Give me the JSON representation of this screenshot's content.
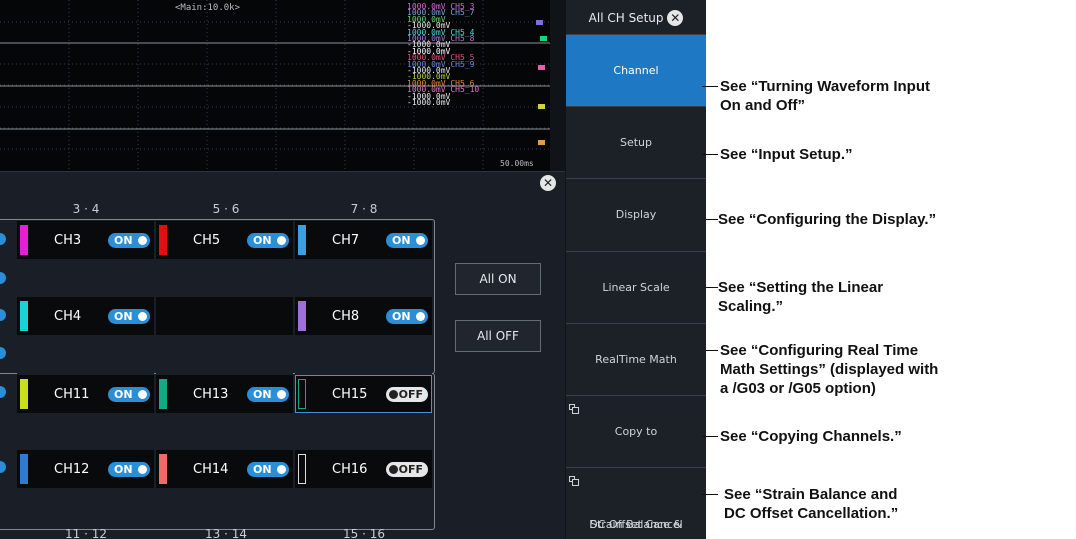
{
  "waveform": {
    "timebase": "<Main:10.0k>",
    "time_div": "50.00ms",
    "trace_labels": [
      {
        "text": "1000.0mV CH5_3",
        "color": "#d46ad4"
      },
      {
        "text": "1000.0mV CH5_7",
        "color": "#7fa0d6"
      },
      {
        "text": "1000.0mV",
        "color": "#6fd36f"
      },
      {
        "text": "-1000.0mV",
        "color": "#e8e8e8"
      },
      {
        "text": "1000.0mV CH5_4",
        "color": "#4fd8d8"
      },
      {
        "text": "1000.0mV CH5_8",
        "color": "#b07ad8"
      },
      {
        "text": "-1000.0mV",
        "color": "#e8e8e8"
      },
      {
        "text": "-1000.0mV",
        "color": "#ffffff"
      },
      {
        "text": "1000.0mV CH5_5",
        "color": "#e0507a"
      },
      {
        "text": "1000.0mV CH5_9",
        "color": "#6a86e0"
      },
      {
        "text": "-1000.0mV",
        "color": "#e8e8e8"
      },
      {
        "text": "-1000.0mV",
        "color": "#b8d040"
      },
      {
        "text": "1000.0mV CH5_6",
        "color": "#e08a40"
      },
      {
        "text": "1000.0mV CH5_10",
        "color": "#d87ac0"
      },
      {
        "text": "-1000.0mV",
        "color": "#e8e8e8"
      },
      {
        "text": "-1000.0mV",
        "color": "#e8e8e8"
      }
    ]
  },
  "panel": {
    "column_headers": [
      "3 · 4",
      "5 · 6",
      "7 · 8"
    ],
    "column_footers": [
      "11 · 12",
      "13 · 14",
      "15 · 16"
    ],
    "channels": [
      {
        "label": "CH3",
        "state": "ON",
        "color": "#e61fd6"
      },
      {
        "label": "CH5",
        "state": "ON",
        "color": "#e01010"
      },
      {
        "label": "CH7",
        "state": "ON",
        "color": "#3d9ee0"
      },
      {
        "label": "CH4",
        "state": "ON",
        "color": "#19d3d8"
      },
      {
        "label": "CH8",
        "state": "ON",
        "color": "#a070d8"
      },
      {
        "label": "CH11",
        "state": "ON",
        "color": "#c8e01a"
      },
      {
        "label": "CH13",
        "state": "ON",
        "color": "#14a884"
      },
      {
        "label": "CH15",
        "state": "OFF",
        "color": "#14a884"
      },
      {
        "label": "CH12",
        "state": "ON",
        "color": "#2e7ad0"
      },
      {
        "label": "CH14",
        "state": "ON",
        "color": "#f06a6a"
      },
      {
        "label": "CH16",
        "state": "OFF",
        "color": "#dddddd"
      }
    ],
    "all_on": "All ON",
    "all_off": "All OFF"
  },
  "menu": {
    "title": "All CH Setup",
    "items": [
      "Channel",
      "Setup",
      "Display",
      "Linear Scale",
      "RealTime Math",
      "Copy to"
    ],
    "strain_line1": "Strain Balance &",
    "strain_line2": "DC Offset Cancel"
  },
  "callouts": [
    {
      "line1": "See “Turning Waveform Input",
      "line2": "On and Off”"
    },
    {
      "line1": "See “Input Setup.”"
    },
    {
      "line1": "See “Configuring the Display.”"
    },
    {
      "line1": "See “Setting the Linear",
      "line2": "Scaling.”"
    },
    {
      "line1": "See “Configuring Real Time",
      "line2": "Math Settings” (displayed with",
      "line3": "a /G03 or /G05 option)"
    },
    {
      "line1": "See “Copying Channels.”"
    },
    {
      "line1": "See “Strain Balance and",
      "line2": "DC Offset Cancellation.”"
    }
  ],
  "colors": {
    "accent": "#1f78c4",
    "toggle_on": "#2a8fd6"
  }
}
